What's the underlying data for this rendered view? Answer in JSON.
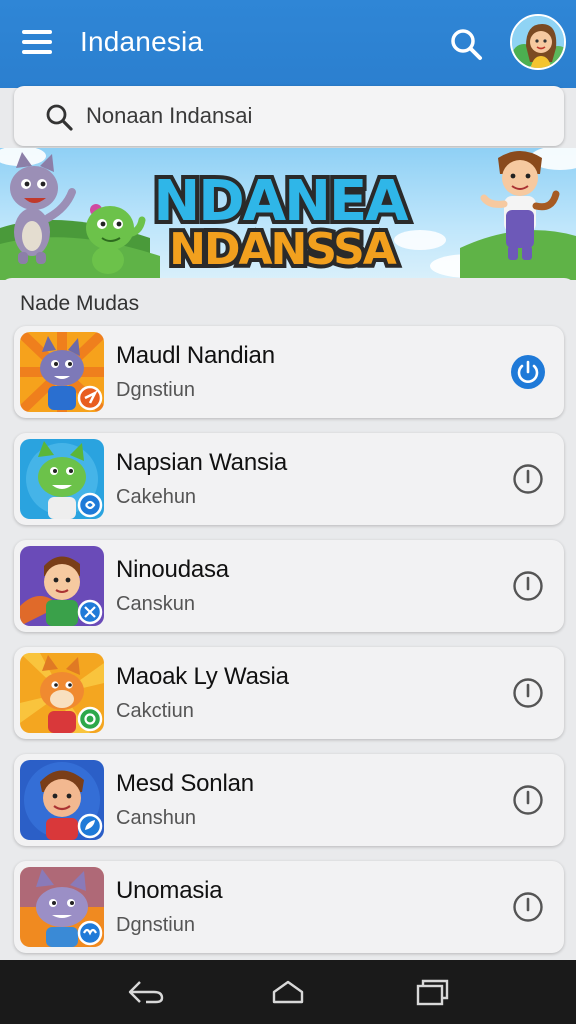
{
  "app_bar": {
    "title": "Indanesia",
    "menu_icon": "menu-icon",
    "search_icon": "search-icon",
    "avatar": "avatar"
  },
  "search": {
    "placeholder": "Nonaan Indansai",
    "icon": "search-icon"
  },
  "banner": {
    "line1": "NDANEA",
    "line2": "NDANSSA"
  },
  "section": {
    "title": "Nade Mudas"
  },
  "apps": [
    {
      "name": "Maudl Nandian",
      "subtitle": "Dgnstiun",
      "active": true,
      "badge_color": "#e85d1f",
      "thumb_bg": "#f6a21c"
    },
    {
      "name": "Napsian Wansia",
      "subtitle": "Cakehun",
      "active": false,
      "badge_color": "#1f7ad8",
      "thumb_bg": "#2aa3df"
    },
    {
      "name": "Ninoudasa",
      "subtitle": "Canskun",
      "active": false,
      "badge_color": "#1f7ad8",
      "thumb_bg": "#6a4bb8"
    },
    {
      "name": "Maoak Ly Wasia",
      "subtitle": "Cakctiun",
      "active": false,
      "badge_color": "#2da84a",
      "thumb_bg": "#f4a620"
    },
    {
      "name": "Mesd Sonlan",
      "subtitle": "Canshun",
      "active": false,
      "badge_color": "#1f7ad8",
      "thumb_bg": "#2b5fc7"
    },
    {
      "name": "Unomasia",
      "subtitle": "Dgnstiun",
      "active": false,
      "badge_color": "#1f7ad8",
      "thumb_bg": "#f08a20"
    }
  ],
  "nav": {
    "back_icon": "back-icon",
    "home_icon": "home-icon",
    "recents_icon": "recents-icon"
  },
  "colors": {
    "app_bar": "#2f86d6",
    "accent": "#1f7ad8",
    "background": "#e9eaec"
  }
}
